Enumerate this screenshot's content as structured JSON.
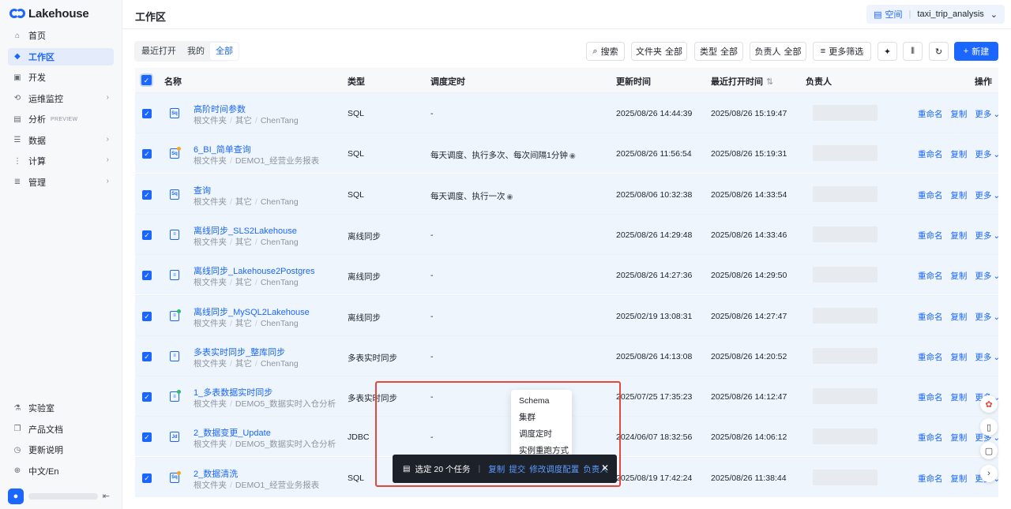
{
  "app": {
    "name": "Lakehouse"
  },
  "sidebar": {
    "items": [
      {
        "label": "首页",
        "icon": "home-icon"
      },
      {
        "label": "工作区",
        "icon": "cube-icon",
        "active": true
      },
      {
        "label": "开发",
        "icon": "terminal-icon"
      },
      {
        "label": "运维监控",
        "icon": "monitor-icon",
        "chevron": true
      },
      {
        "label": "分析",
        "icon": "analysis-icon",
        "badge": "PREVIEW"
      },
      {
        "label": "数据",
        "icon": "database-icon",
        "chevron": true
      },
      {
        "label": "计算",
        "icon": "compute-icon",
        "chevron": true
      },
      {
        "label": "管理",
        "icon": "manage-icon",
        "chevron": true
      }
    ],
    "bottom_items": [
      {
        "label": "实验室",
        "icon": "flask-icon"
      },
      {
        "label": "产品文档",
        "icon": "book-icon"
      },
      {
        "label": "更新说明",
        "icon": "update-icon"
      },
      {
        "label": "中文/En",
        "icon": "globe-icon"
      }
    ]
  },
  "header": {
    "title": "工作区",
    "workspace_label": "空间",
    "workspace_name": "taxi_trip_analysis"
  },
  "toolbar": {
    "tabs": [
      "最近打开",
      "我的",
      "全部"
    ],
    "active_tab": "全部",
    "search": "搜索",
    "folder_label": "文件夹",
    "folder_value": "全部",
    "type_label": "类型",
    "type_value": "全部",
    "owner_label": "负责人",
    "owner_value": "全部",
    "more_filter": "更多筛选",
    "new_button": "新建"
  },
  "table": {
    "headers": {
      "name": "名称",
      "type": "类型",
      "schedule": "调度定时",
      "updated": "更新时间",
      "opened": "最近打开时间",
      "owner": "负责人",
      "actions": "操作"
    },
    "actions": {
      "rename": "重命名",
      "copy": "复制",
      "more": "更多"
    },
    "rows": [
      {
        "icon_text": "Sq",
        "name": "高阶时间参数",
        "path": [
          "根文件夹",
          "其它",
          "ChenTang"
        ],
        "type": "SQL",
        "schedule": "-",
        "updated": "2025/08/26 14:44:39",
        "opened": "2025/08/26 15:19:47"
      },
      {
        "icon_text": "Sq",
        "icon_dot": "#f5a623",
        "name": "6_BI_简单查询",
        "path": [
          "根文件夹",
          "DEMO1_经营业务报表"
        ],
        "type": "SQL",
        "schedule": "每天调度、执行多次、每次间隔1分钟",
        "schedule_eye": true,
        "updated": "2025/08/26 11:56:54",
        "opened": "2025/08/26 15:19:31"
      },
      {
        "icon_text": "Sq",
        "name": "查询",
        "path": [
          "根文件夹",
          "其它",
          "ChenTang"
        ],
        "type": "SQL",
        "schedule": "每天调度、执行一次",
        "schedule_eye": true,
        "updated": "2025/08/06 10:32:38",
        "opened": "2025/08/26 14:33:54"
      },
      {
        "icon_text": "≡",
        "name": "离线同步_SLS2Lakehouse",
        "path": [
          "根文件夹",
          "其它",
          "ChenTang"
        ],
        "type": "离线同步",
        "schedule": "-",
        "updated": "2025/08/26 14:29:48",
        "opened": "2025/08/26 14:33:46"
      },
      {
        "icon_text": "≡",
        "name": "离线同步_Lakehouse2Postgres",
        "path": [
          "根文件夹",
          "其它",
          "ChenTang"
        ],
        "type": "离线同步",
        "schedule": "-",
        "updated": "2025/08/26 14:27:36",
        "opened": "2025/08/26 14:29:50"
      },
      {
        "icon_text": "≡",
        "icon_dot": "#2dbb6b",
        "name": "离线同步_MySQL2Lakehouse",
        "path": [
          "根文件夹",
          "其它",
          "ChenTang"
        ],
        "type": "离线同步",
        "schedule": "-",
        "updated": "2025/02/19 13:08:31",
        "opened": "2025/08/26 14:27:47"
      },
      {
        "icon_text": "≡",
        "name": "多表实时同步_整库同步",
        "path": [
          "根文件夹",
          "其它",
          "ChenTang"
        ],
        "type": "多表实时同步",
        "schedule": "-",
        "updated": "2025/08/26 14:13:08",
        "opened": "2025/08/26 14:20:52"
      },
      {
        "icon_text": "≡",
        "icon_dot": "#2dbb6b",
        "name": "1_多表数据实时同步",
        "path": [
          "根文件夹",
          "DEMO5_数据实时入仓分析"
        ],
        "type": "多表实时同步",
        "schedule": "-",
        "updated": "2025/07/25 17:35:23",
        "opened": "2025/08/26 14:12:47"
      },
      {
        "icon_text": "Jd",
        "name": "2_数据变更_Update",
        "path": [
          "根文件夹",
          "DEMO5_数据实时入仓分析"
        ],
        "type": "JDBC",
        "schedule": "-",
        "updated": "2024/06/07 18:32:56",
        "opened": "2025/08/26 14:06:12"
      },
      {
        "icon_text": "Sq",
        "icon_dot": "#f5a623",
        "name": "2_数据清洗",
        "path": [
          "根文件夹",
          "DEMO1_经营业务报表"
        ],
        "type": "SQL",
        "schedule": "-",
        "updated": "2025/08/19 17:42:24",
        "opened": "2025/08/26 11:38:44"
      }
    ]
  },
  "popover_menu": [
    "Schema",
    "集群",
    "调度定时",
    "实例重跑方式"
  ],
  "action_bar": {
    "selected": "选定 20 个任务",
    "actions": [
      "复制",
      "提交",
      "修改调度配置",
      "负责人"
    ]
  }
}
